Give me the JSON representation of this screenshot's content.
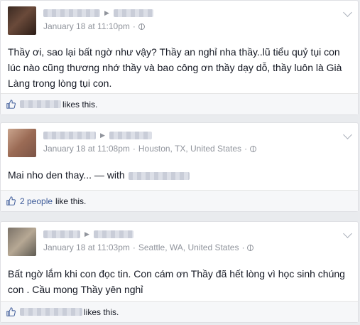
{
  "posts": [
    {
      "timestamp": "January 18 at 11:10pm",
      "location": "",
      "text": "Thầy ơi, sao lại bất ngờ như vậy? Thầy an nghỉ nha thầy..lũ tiểu quỷ tụi con lúc nào cũng thương nhớ thầy và bao công ơn thầy dạy dỗ, thầy luôn là Già Làng trong lòng tụi con.",
      "likes_text": "likes this."
    },
    {
      "timestamp": "January 18 at 11:08pm",
      "location": "Houston, TX, United States",
      "text": "Mai nho den thay... — with",
      "likes_people": "2 people",
      "likes_text": "like this."
    },
    {
      "timestamp": "January 18 at 11:03pm",
      "location": "Seattle, WA, United States",
      "text": "Bất ngờ lắm khi con đọc tin. Con cám ơn Thầy đã hết lòng vì học sinh chúng con . Cầu mong Thầy yên nghỉ",
      "likes_text": "likes this."
    }
  ],
  "separator": "·",
  "colors": {
    "link": "#3b5998",
    "meta": "#90949c",
    "text": "#141823",
    "background": "#e9ebee"
  },
  "icons": {
    "like": "thumbs-up-icon",
    "privacy": "globe-icon",
    "menu": "chevron-down-icon",
    "share_to": "triangle-right-icon"
  }
}
